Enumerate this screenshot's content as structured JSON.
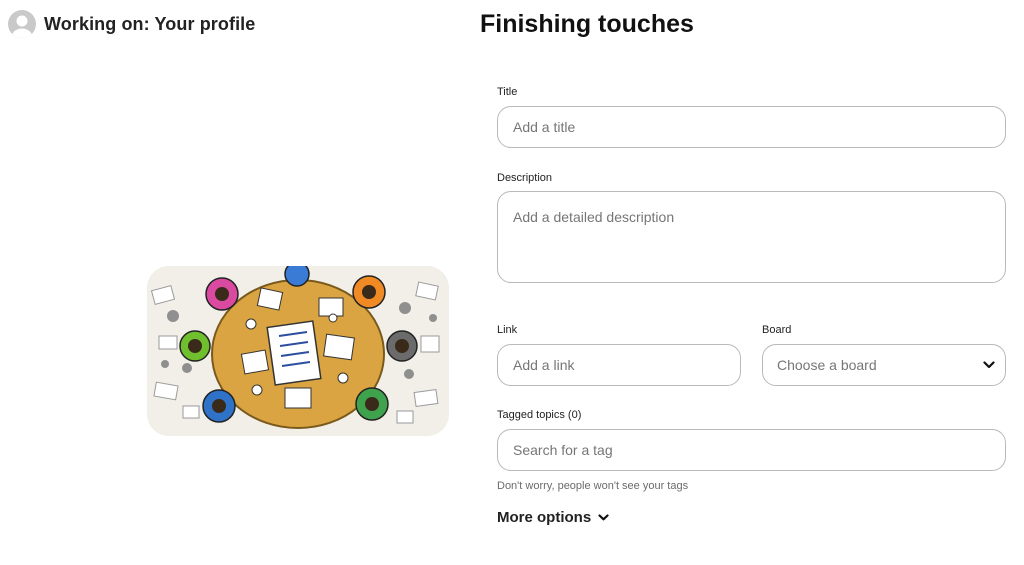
{
  "header": {
    "title": "Working on: Your profile",
    "avatar_icon": "user-avatar-icon"
  },
  "page_title": "Finishing touches",
  "preview": {
    "description_icon": "team-meeting-illustration"
  },
  "form": {
    "title": {
      "label": "Title",
      "placeholder": "Add a title"
    },
    "description": {
      "label": "Description",
      "placeholder": "Add a detailed description"
    },
    "link": {
      "label": "Link",
      "placeholder": "Add a link"
    },
    "board": {
      "label": "Board",
      "placeholder": "Choose a board",
      "icon": "chevron-down-icon"
    },
    "tagged_topics": {
      "label": "Tagged topics (0)",
      "placeholder": "Search for a tag"
    },
    "hint": "Don't worry, people won't see your tags",
    "more_options": "More options"
  },
  "colors": {
    "border": "#b9b9b9",
    "placeholder": "#767676",
    "text": "#111111"
  }
}
